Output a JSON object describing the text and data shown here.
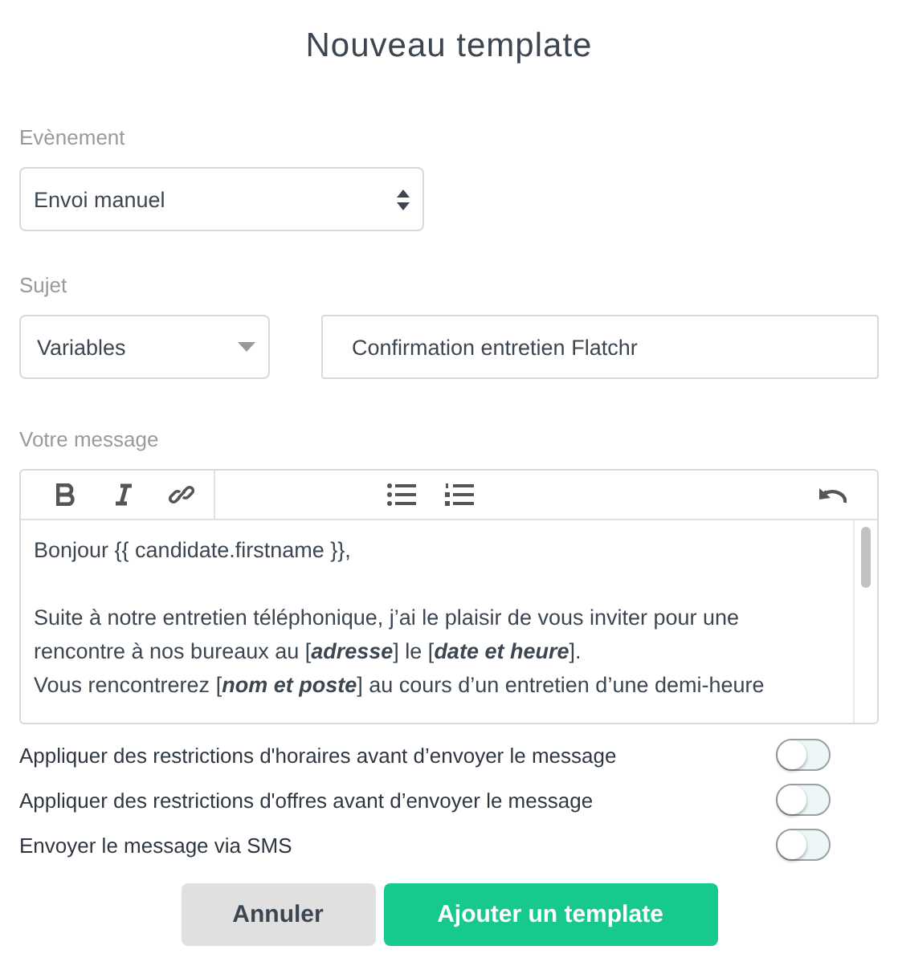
{
  "title": "Nouveau template",
  "event": {
    "label": "Evènement",
    "value": "Envoi manuel"
  },
  "subject": {
    "label": "Sujet",
    "variables": "Variables",
    "value": "Confirmation entretien Flatchr"
  },
  "message": {
    "label": "Votre message",
    "paragraphs": [
      {
        "lines": [
          "Bonjour  {{ candidate.firstname }},"
        ]
      },
      {
        "lines": [
          "Suite à notre entretien téléphonique, j’ai le plaisir de vous inviter pour une",
          "rencontre à nos bureaux au [**adresse**] le [**date et heure**].",
          "Vous rencontrerez [**nom et poste**] au cours d’un entretien d’une demi-heure"
        ]
      }
    ]
  },
  "options": [
    {
      "label": "Appliquer des restrictions d'horaires avant d’envoyer le message",
      "on": false
    },
    {
      "label": "Appliquer des restrictions d'offres avant d’envoyer le message",
      "on": false
    },
    {
      "label": "Envoyer le message via SMS",
      "on": false
    }
  ],
  "buttons": [
    {
      "label": "Annuler",
      "kind": "secondary"
    },
    {
      "label": "Ajouter un template",
      "kind": "primary"
    }
  ]
}
